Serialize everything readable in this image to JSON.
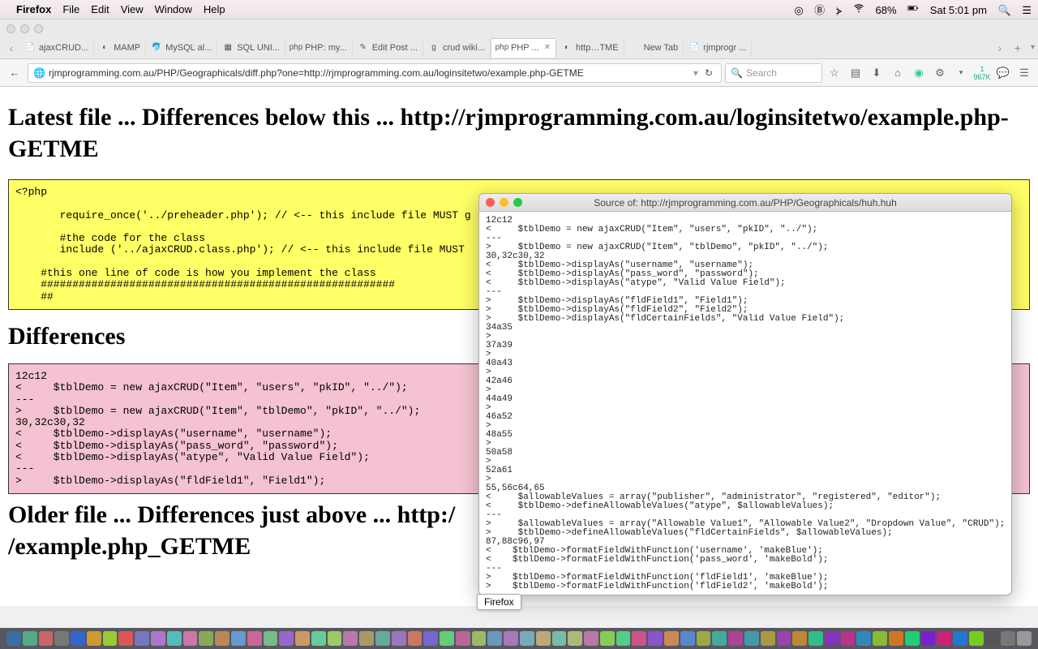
{
  "menubar": {
    "app": "Firefox",
    "items": [
      "File",
      "Edit",
      "View",
      "Window",
      "Help"
    ],
    "battery": "68%",
    "clock": "Sat 5:01 pm"
  },
  "tabs": [
    {
      "label": "ajaxCRUD...",
      "icon": "📄"
    },
    {
      "label": "MAMP",
      "icon": "◐"
    },
    {
      "label": "MySQL al...",
      "icon": "🐬"
    },
    {
      "label": "SQL UNI...",
      "icon": "▦"
    },
    {
      "label": "PHP: my...",
      "icon": "php"
    },
    {
      "label": "Edit Post ...",
      "icon": "✎"
    },
    {
      "label": "crud wiki...",
      "icon": "g"
    },
    {
      "label": "PHP ...",
      "icon": "php",
      "active": true
    },
    {
      "label": "http…TME",
      "icon": "◐"
    },
    {
      "label": "New Tab",
      "icon": ""
    },
    {
      "label": "rjmprogr ...",
      "icon": "📄"
    }
  ],
  "url": "rjmprogramming.com.au/PHP/Geographicals/diff.php?one=http://rjmprogramming.com.au/loginsitetwo/example.php-GETME",
  "search_placeholder": "Search",
  "stats": "1 967K",
  "page": {
    "h1": "Latest file ... Differences below this ... http://rjmprogramming.com.au/loginsitetwo/example.php-GETME",
    "code1": "<?php\n\n       require_once('../preheader.php'); // <-- this include file MUST g\n\n       #the code for the class\n       include ('../ajaxCRUD.class.php'); // <-- this include file MUST \n\n    #this one line of code is how you implement the class\n    ########################################################\n    ##",
    "h2": "Differences",
    "code2": "12c12\n<     $tblDemo = new ajaxCRUD(\"Item\", \"users\", \"pkID\", \"../\");\n---\n>     $tblDemo = new ajaxCRUD(\"Item\", \"tblDemo\", \"pkID\", \"../\");\n30,32c30,32\n<     $tblDemo->displayAs(\"username\", \"username\");\n<     $tblDemo->displayAs(\"pass_word\", \"password\");\n<     $tblDemo->displayAs(\"atype\", \"Valid Value Field\");\n---\n>     $tblDemo->displayAs(\"fldField1\", \"Field1\");",
    "h3": "Older file ... Differences just above ... http://example.php_GETME",
    "h3_line1": "Older file ... Differences just above ... http:/",
    "h3_line2": "/example.php_GETME"
  },
  "popup": {
    "title": "Source of: http://rjmprogramming.com.au/PHP/Geographicals/huh.huh",
    "body": "12c12\n<     $tblDemo = new ajaxCRUD(\"Item\", \"users\", \"pkID\", \"../\");\n---\n>     $tblDemo = new ajaxCRUD(\"Item\", \"tblDemo\", \"pkID\", \"../\");\n30,32c30,32\n<     $tblDemo->displayAs(\"username\", \"username\");\n<     $tblDemo->displayAs(\"pass_word\", \"password\");\n<     $tblDemo->displayAs(\"atype\", \"Valid Value Field\");\n---\n>     $tblDemo->displayAs(\"fldField1\", \"Field1\");\n>     $tblDemo->displayAs(\"fldField2\", \"Field2\");\n>     $tblDemo->displayAs(\"fldCertainFields\", \"Valid Value Field\");\n34a35\n>\n37a39\n>\n40a43\n>\n42a46\n>\n44a49\n>\n46a52\n>\n48a55\n>\n50a58\n>\n52a61\n>\n55,56c64,65\n<     $allowableValues = array(\"publisher\", \"administrator\", \"registered\", \"editor\");\n<     $tblDemo->defineAllowableValues(\"atype\", $allowableValues);\n---\n>     $allowableValues = array(\"Allowable Value1\", \"Allowable Value2\", \"Dropdown Value\", \"CRUD\");\n>     $tblDemo->defineAllowableValues(\"fldCertainFields\", $allowableValues);\n87,88c96,97\n<    $tblDemo->formatFieldWithFunction('username', 'makeBlue');\n<    $tblDemo->formatFieldWithFunction('pass_word', 'makeBold');\n---\n>    $tblDemo->formatFieldWithFunction('fldField1', 'makeBlue');\n>    $tblDemo->formatFieldWithFunction('fldField2', 'makeBold');"
  },
  "tooltip": "Firefox",
  "dock_colors": [
    "#3b6ea5",
    "#5a8",
    "#c66",
    "#777",
    "#36c",
    "#c93",
    "#9c3",
    "#d55",
    "#77b",
    "#a7c",
    "#5bb",
    "#c7a",
    "#8a5",
    "#b85",
    "#69c",
    "#c69",
    "#7b8",
    "#96c",
    "#c96",
    "#6c9",
    "#9c6",
    "#b7a",
    "#a96",
    "#6a9",
    "#97b",
    "#c76",
    "#76c",
    "#6c7",
    "#b69",
    "#9b6",
    "#69b",
    "#a7b",
    "#7ab",
    "#ba7",
    "#7ba",
    "#ab7",
    "#b7a",
    "#8c5",
    "#5c8",
    "#c58",
    "#85c",
    "#c85",
    "#58c",
    "#9a4",
    "#4a9",
    "#a49",
    "#49a",
    "#a94",
    "#94a",
    "#b83",
    "#3b8",
    "#83b",
    "#b38",
    "#38b",
    "#8b3",
    "#c72",
    "#2c7",
    "#72c",
    "#c27",
    "#27c",
    "#7c2",
    "#555",
    "#777",
    "#999"
  ]
}
